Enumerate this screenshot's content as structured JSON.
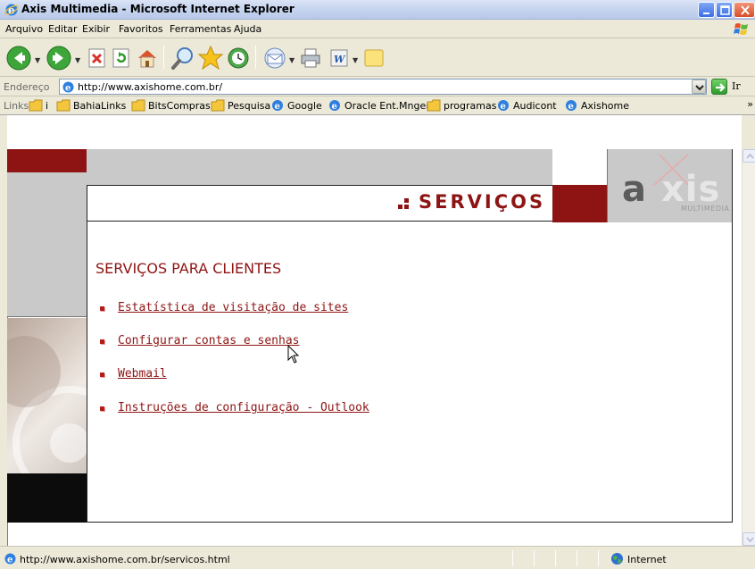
{
  "window": {
    "title": "Axis Multimedia - Microsoft Internet Explorer"
  },
  "menu": [
    "Arquivo",
    "Editar",
    "Exibir",
    "Favoritos",
    "Ferramentas",
    "Ajuda"
  ],
  "toolbar": {
    "icons": [
      "back-icon",
      "forward-icon",
      "stop-icon",
      "refresh-icon",
      "home-icon",
      "search-icon",
      "favorites-icon",
      "history-icon",
      "mail-icon",
      "print-icon",
      "edit-icon",
      "notes-icon"
    ]
  },
  "address": {
    "label": "Endereço",
    "url": "http://www.axishome.com.br/",
    "go_label": "Ir"
  },
  "links": {
    "label": "Links",
    "items": [
      "i",
      "BahiaLinks",
      "BitsCompras",
      "Pesquisa",
      "Google",
      "Oracle Ent.Mnger",
      "programas",
      "Audicont",
      "Axishome"
    ],
    "more": "»"
  },
  "page": {
    "logo_a": "a",
    "logo_xis": "xis",
    "logo_sub": "MULTIMEDIA",
    "section_word": "SERVIÇOS",
    "title": "SERVIÇOS PARA CLIENTES",
    "services": [
      "Estatística de visitação de sites",
      "Configurar contas e senhas",
      "Webmail",
      "Instruções de configuração - Outlook"
    ]
  },
  "status": {
    "message": "http://www.axishome.com.br/servicos.html",
    "zone": "Internet"
  },
  "colors": {
    "brand_red": "#8e1414",
    "header_grey": "#c9c9c9",
    "xp_blue": "#3a6ee8"
  }
}
